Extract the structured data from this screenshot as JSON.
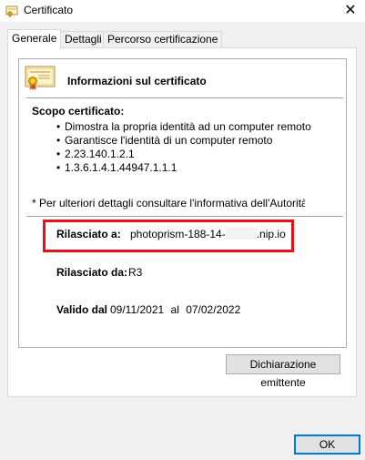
{
  "window": {
    "title": "Certificato",
    "close_glyph": "✕"
  },
  "tabs": [
    {
      "label": "Generale",
      "active": true
    },
    {
      "label": "Dettagli",
      "active": false
    },
    {
      "label": "Percorso certificazione",
      "active": false
    }
  ],
  "info": {
    "title": "Informazioni sul certificato"
  },
  "scope": {
    "title": "Scopo certificato:",
    "items": [
      "Dimostra la propria identità ad un computer remoto",
      "Garantisce l'identità di un computer remoto",
      "2.23.140.1.2.1",
      "1.3.6.1.4.1.44947.1.1.1"
    ]
  },
  "note": "* Per ulteriori dettagli consultare l'informativa dell'Autorità di ce",
  "issued_to": {
    "label": "Rilasciato a:",
    "value_prefix": "photoprism-188-14-",
    "value_suffix": ".nip.io"
  },
  "issued_by": {
    "label": "Rilasciato da:",
    "value": "R3"
  },
  "validity": {
    "label": "Valido dal",
    "from": "09/11/2021",
    "connector": "al",
    "to": "07/02/2022"
  },
  "buttons": {
    "issuer_statement": "Dichiarazione emittente",
    "ok": "OK"
  },
  "colors": {
    "highlight_box": "#e8101d",
    "ok_border": "#0078d7"
  },
  "icons": {
    "window_icon": "certificate-small-icon",
    "cert_icon": "certificate-ribbon-icon"
  }
}
